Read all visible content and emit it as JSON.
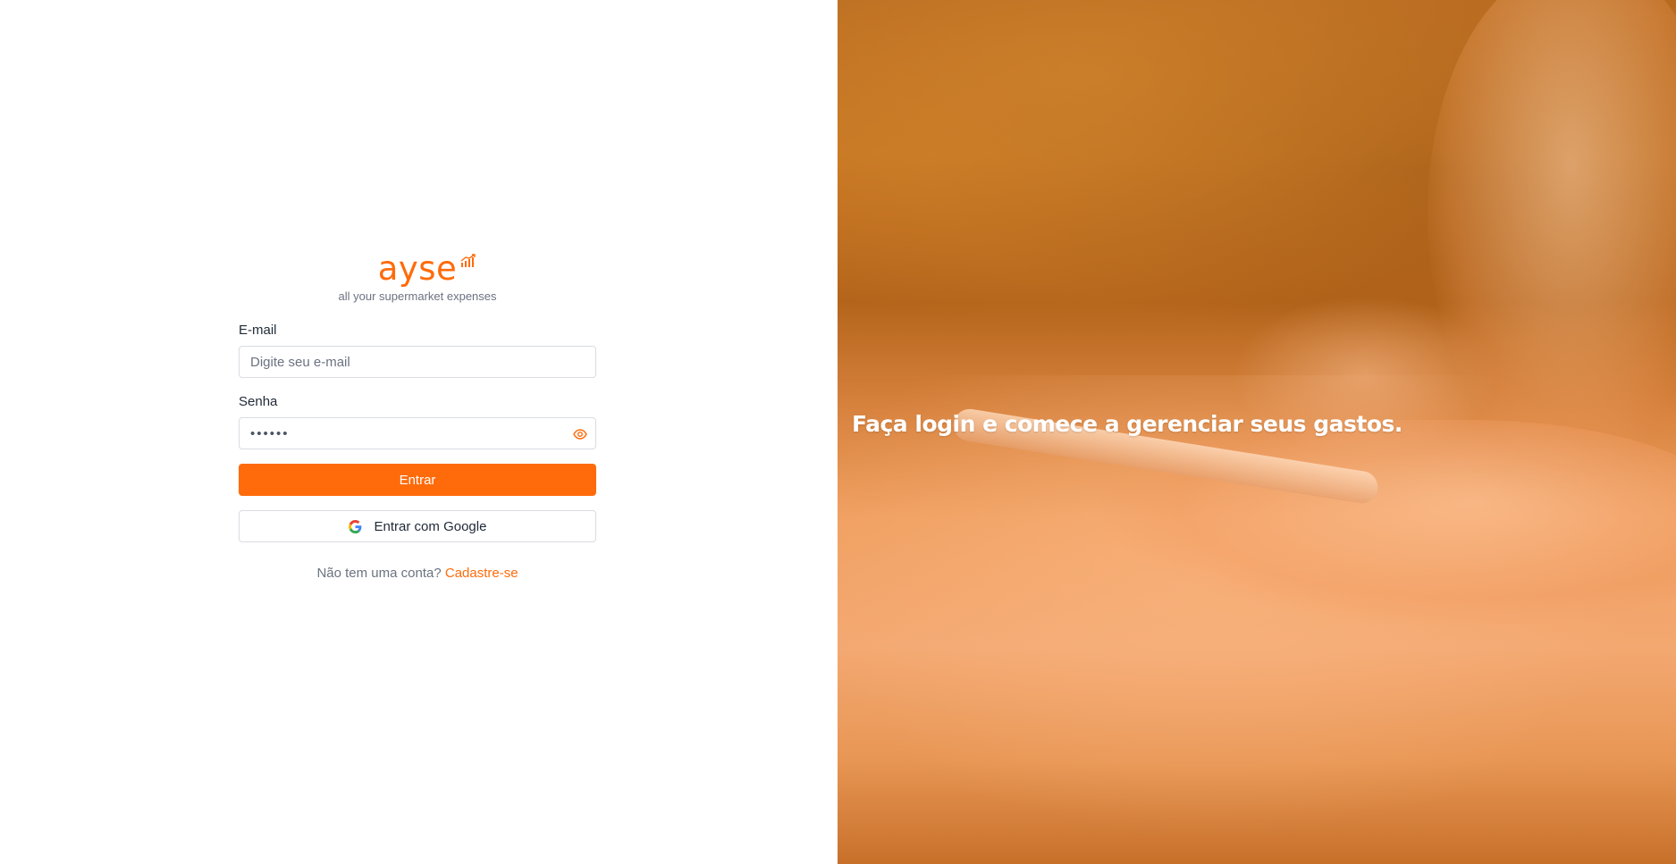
{
  "brand": {
    "name": "ayse",
    "tagline": "all your supermarket expenses",
    "accent_color": "#ff6b0a"
  },
  "form": {
    "email_label": "E-mail",
    "email_placeholder": "Digite seu e-mail",
    "email_value": "",
    "password_label": "Senha",
    "password_value": "••••••",
    "show_password_icon": "eye-icon",
    "submit_label": "Entrar",
    "google_label": "Entrar com Google",
    "google_icon": "google-icon"
  },
  "signup": {
    "prompt": "Não tem uma conta?",
    "link_label": "Cadastre-se"
  },
  "hero": {
    "text": "Faça login e comece a gerenciar seus gastos."
  }
}
